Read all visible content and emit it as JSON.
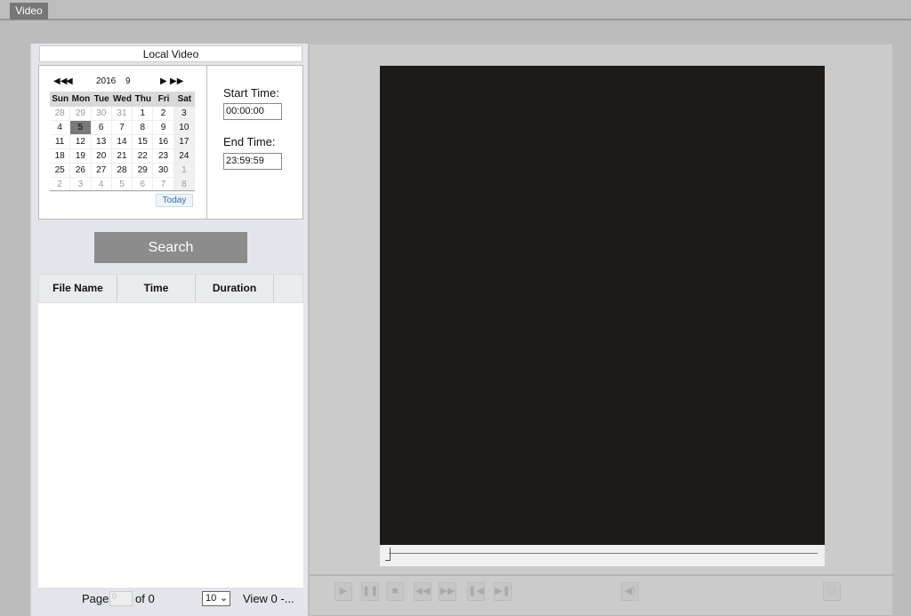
{
  "tab": {
    "label": "Video"
  },
  "panel_title": "Local Video",
  "calendar": {
    "year": 2016,
    "month": 9,
    "weekdays": [
      "Sun",
      "Mon",
      "Tue",
      "Wed",
      "Thu",
      "Fri",
      "Sat"
    ],
    "days": [
      [
        "28",
        1
      ],
      [
        "29",
        1
      ],
      [
        "30",
        1
      ],
      [
        "31",
        1
      ],
      [
        "1",
        0
      ],
      [
        "2",
        0
      ],
      [
        "3",
        0
      ],
      [
        "4",
        0
      ],
      [
        "5",
        2
      ],
      [
        "6",
        0
      ],
      [
        "7",
        0
      ],
      [
        "8",
        0
      ],
      [
        "9",
        0
      ],
      [
        "10",
        0
      ],
      [
        "11",
        0
      ],
      [
        "12",
        0
      ],
      [
        "13",
        0
      ],
      [
        "14",
        0
      ],
      [
        "15",
        0
      ],
      [
        "16",
        0
      ],
      [
        "17",
        0
      ],
      [
        "18",
        0
      ],
      [
        "19",
        0
      ],
      [
        "20",
        0
      ],
      [
        "21",
        0
      ],
      [
        "22",
        0
      ],
      [
        "23",
        0
      ],
      [
        "24",
        0
      ],
      [
        "25",
        0
      ],
      [
        "26",
        0
      ],
      [
        "27",
        0
      ],
      [
        "28",
        0
      ],
      [
        "29",
        0
      ],
      [
        "30",
        0
      ],
      [
        "1",
        1
      ],
      [
        "2",
        1
      ],
      [
        "3",
        1
      ],
      [
        "4",
        1
      ],
      [
        "5",
        1
      ],
      [
        "6",
        1
      ],
      [
        "7",
        1
      ],
      [
        "8",
        1
      ]
    ],
    "today_label": "Today"
  },
  "start_time": {
    "label": "Start Time:",
    "value": "00:00:00"
  },
  "end_time": {
    "label": "End Time:",
    "value": "23:59:59"
  },
  "search_label": "Search",
  "table": {
    "columns": [
      "File Name",
      "Time",
      "Duration"
    ],
    "rows": []
  },
  "pager": {
    "page_label": "Page",
    "page_value": "0",
    "of_label": "of 0",
    "per_page": "10",
    "view_label": "View 0 -..."
  },
  "player": {
    "progress": 0
  }
}
